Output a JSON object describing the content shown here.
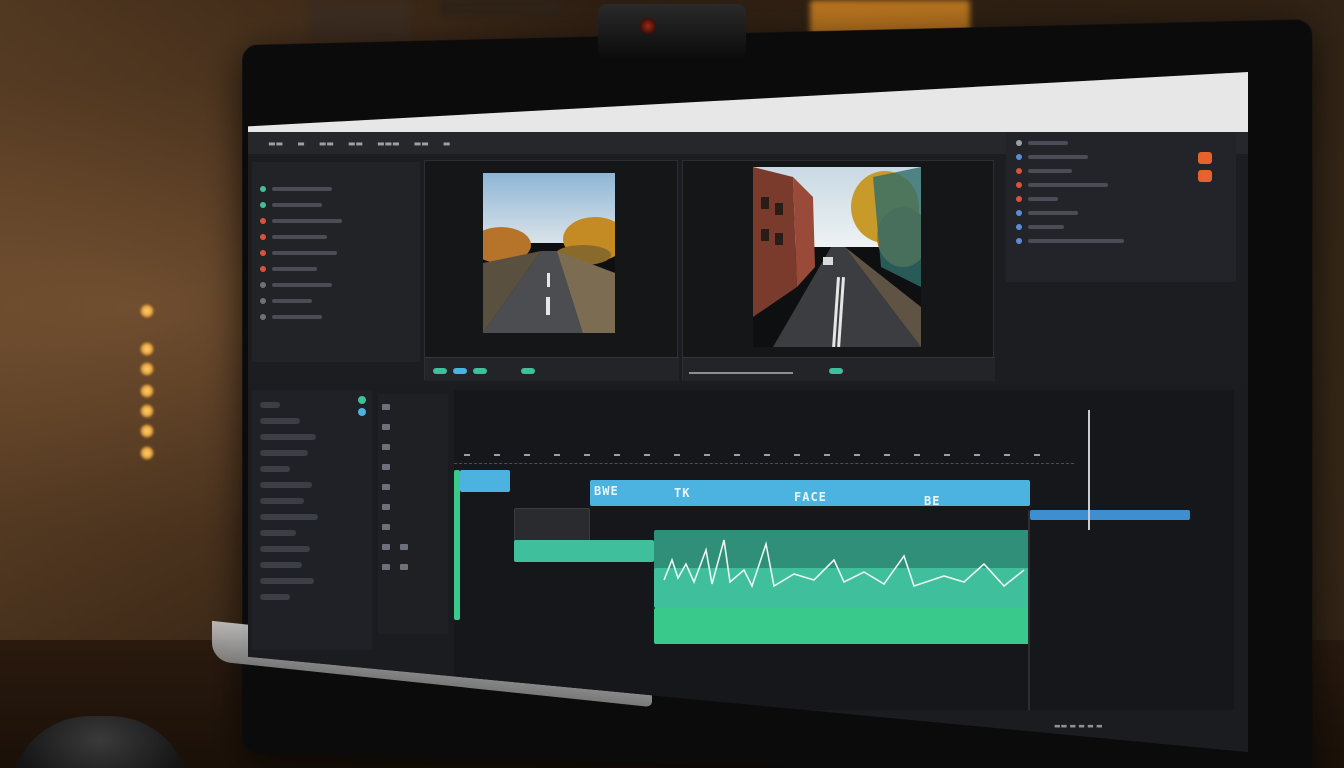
{
  "scene": {
    "description_tags": [
      "desk",
      "monitor",
      "webcam",
      "video-editor",
      "warm-lights",
      "mouse"
    ]
  },
  "colors": {
    "accent_teal": "#3fbf9c",
    "accent_blue": "#4cb3e0",
    "clip_green": "#39c98a",
    "badge_orange": "#e8622b",
    "ui_dark": "#1c1d20"
  },
  "editor": {
    "timeline_clip_labels": [
      "BWE",
      "TK",
      "FACE",
      "BE"
    ],
    "icons": [
      "play-icon",
      "pause-icon",
      "cut-icon",
      "settings-icon",
      "grid-icon"
    ]
  }
}
